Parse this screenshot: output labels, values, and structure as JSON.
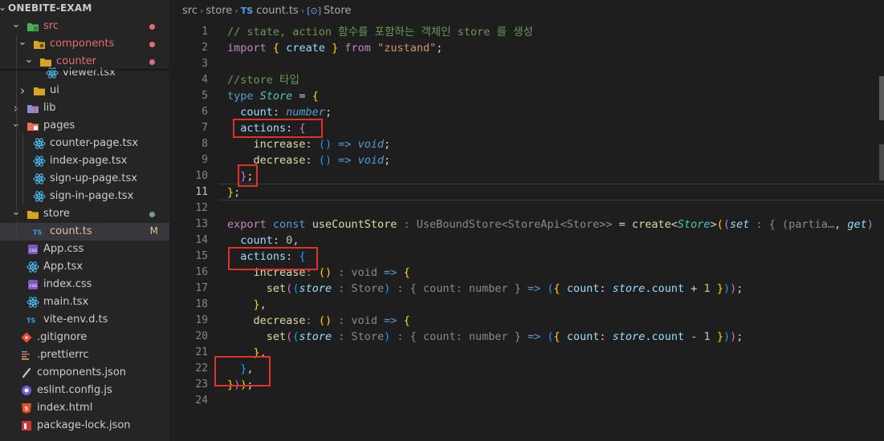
{
  "sidebar": {
    "root_title": "ONEBITE-EXAM",
    "items": [
      {
        "label": "src",
        "kind": "folder-open",
        "icon": "folder-src-icon",
        "color": "#e06c75",
        "status": "dot"
      },
      {
        "label": "components",
        "kind": "folder-open",
        "icon": "folder-components-icon",
        "color": "#e06c75",
        "status": "dot"
      },
      {
        "label": "counter",
        "kind": "folder-open",
        "icon": "folder-icon",
        "color": "#e06c75",
        "status": "dot"
      },
      {
        "label": "viewer.tsx",
        "kind": "file",
        "icon": "react-icon",
        "color": "#cccccc",
        "status": ""
      },
      {
        "label": "ui",
        "kind": "folder-closed",
        "icon": "folder-icon",
        "color": "#cccccc",
        "status": ""
      },
      {
        "label": "lib",
        "kind": "folder-closed",
        "icon": "folder-lib-icon",
        "color": "#cccccc",
        "status": ""
      },
      {
        "label": "pages",
        "kind": "folder-open",
        "icon": "folder-pages-icon",
        "color": "#cccccc",
        "status": ""
      },
      {
        "label": "counter-page.tsx",
        "kind": "file",
        "icon": "react-icon",
        "color": "#cccccc",
        "status": ""
      },
      {
        "label": "index-page.tsx",
        "kind": "file",
        "icon": "react-icon",
        "color": "#cccccc",
        "status": ""
      },
      {
        "label": "sign-up-page.tsx",
        "kind": "file",
        "icon": "react-icon",
        "color": "#cccccc",
        "status": ""
      },
      {
        "label": "sign-in-page.tsx",
        "kind": "file",
        "icon": "react-icon",
        "color": "#cccccc",
        "status": ""
      },
      {
        "label": "store",
        "kind": "folder-open",
        "icon": "folder-icon",
        "color": "#cccccc",
        "status": "dot-green"
      },
      {
        "label": "count.ts",
        "kind": "file",
        "icon": "ts-icon",
        "color": "#e2c08d",
        "status": "M"
      },
      {
        "label": "App.css",
        "kind": "file",
        "icon": "css-icon",
        "color": "#cccccc",
        "status": ""
      },
      {
        "label": "App.tsx",
        "kind": "file",
        "icon": "react-icon",
        "color": "#cccccc",
        "status": ""
      },
      {
        "label": "index.css",
        "kind": "file",
        "icon": "css-icon",
        "color": "#cccccc",
        "status": ""
      },
      {
        "label": "main.tsx",
        "kind": "file",
        "icon": "react-icon",
        "color": "#cccccc",
        "status": ""
      },
      {
        "label": "vite-env.d.ts",
        "kind": "file",
        "icon": "ts-icon",
        "color": "#cccccc",
        "status": ""
      },
      {
        "label": ".gitignore",
        "kind": "file",
        "icon": "git-icon",
        "color": "#cccccc",
        "status": ""
      },
      {
        "label": ".prettierrc",
        "kind": "file",
        "icon": "prettier-icon",
        "color": "#cccccc",
        "status": ""
      },
      {
        "label": "components.json",
        "kind": "file",
        "icon": "json-icon",
        "color": "#cccccc",
        "status": ""
      },
      {
        "label": "eslint.config.js",
        "kind": "file",
        "icon": "eslint-icon",
        "color": "#cccccc",
        "status": ""
      },
      {
        "label": "index.html",
        "kind": "file",
        "icon": "html-icon",
        "color": "#cccccc",
        "status": ""
      },
      {
        "label": "package-lock.json",
        "kind": "file",
        "icon": "npm-icon",
        "color": "#cccccc",
        "status": ""
      }
    ]
  },
  "breadcrumb": {
    "segments": [
      "src",
      "store",
      "count.ts",
      "Store"
    ],
    "file_badge": "TS"
  },
  "editor": {
    "active_line": 11,
    "line_numbers": [
      "1",
      "2",
      "3",
      "4",
      "5",
      "6",
      "7",
      "8",
      "9",
      "10",
      "11",
      "12",
      "13",
      "14",
      "15",
      "16",
      "17",
      "18",
      "19",
      "20",
      "21",
      "22",
      "23",
      "24"
    ],
    "lines": {
      "l1": "// state, action 함수를 포함하는 객체인 store 를 생성",
      "l4": "//store 타입",
      "zustand": "\"zustand\"",
      "store_type": "Store",
      "use_count_store": "useCountStore",
      "hint_type": ": UseBoundStore<StoreApi<Store>>",
      "hint_set": ": { (partia…"
    }
  },
  "colors": {
    "annotation_box": "#e0312b",
    "modified": "#e2c08d",
    "error_dot": "#e06c75",
    "ok_dot": "#73c991"
  }
}
